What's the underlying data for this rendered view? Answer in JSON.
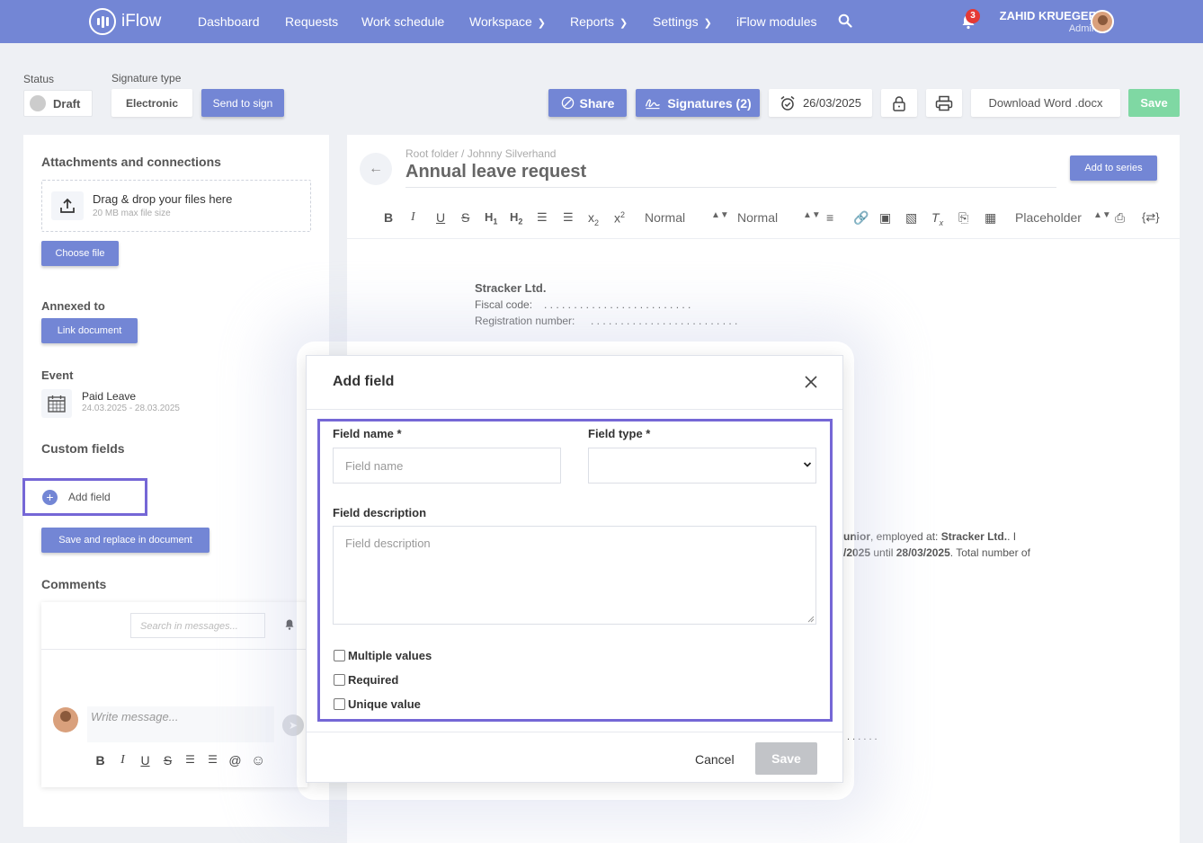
{
  "app": {
    "brand": "iFlow",
    "accent_color": "#7386d5",
    "highlight_color": "#7567d6"
  },
  "nav": {
    "items": [
      {
        "label": "Dashboard"
      },
      {
        "label": "Requests"
      },
      {
        "label": "Work schedule"
      },
      {
        "label": "Workspace"
      },
      {
        "label": "Reports"
      },
      {
        "label": "Settings"
      },
      {
        "label": "iFlow modules"
      }
    ],
    "notification_count": "3",
    "user_name": "ZAHID KRUEGER",
    "user_role": "Admin"
  },
  "toolbar": {
    "status_label": "Status",
    "status_value": "Draft",
    "signature_type_label": "Signature type",
    "signature_type_value": "Electronic",
    "send_to_sign": "Send to sign",
    "share": "Share",
    "signatures": "Signatures (2)",
    "date": "26/03/2025",
    "download": "Download Word .docx",
    "save": "Save"
  },
  "sidebar": {
    "attachments_title": "Attachments and connections",
    "dropzone_title": "Drag & drop your files here",
    "dropzone_sub": "20 MB max file size",
    "choose_file": "Choose file",
    "annexed_title": "Annexed to",
    "link_document": "Link document",
    "event_title": "Event",
    "event_name": "Paid Leave",
    "event_dates": "24.03.2025 - 28.03.2025",
    "custom_fields_title": "Custom fields",
    "add_field": "Add field",
    "save_replace": "Save and replace in document",
    "comments_title": "Comments",
    "search_placeholder": "Search in messages...",
    "write_placeholder": "Write message..."
  },
  "document": {
    "breadcrumb": "Root folder / Johnny Silverhand",
    "title": "Annual leave request",
    "add_to_series": "Add to series",
    "editor": {
      "format_1": "Normal",
      "format_2": "Normal",
      "placeholder": "Placeholder"
    },
    "company": "Stracker Ltd.",
    "fiscal_code": "Fiscal code:",
    "fiscal_dots": ". . . . . . . . . . . . . . . . . . . . . . . . .",
    "registration": "Registration number:",
    "registration_dots": ". . . . . . . . . . . . . . . . . . . . . . . . .",
    "body_frag1_bold": "unior",
    "body_frag1_rest": ", employed at: ",
    "body_frag1_company": "Stracker Ltd.",
    "body_frag1_end": ". I",
    "body_frag2_date1": "/2025",
    "body_frag2_mid": " until ",
    "body_frag2_date2": "28/03/2025",
    "body_frag2_end": ". Total number of",
    "dots_tail": ". . . . . ."
  },
  "modal": {
    "title": "Add field",
    "field_name_label": "Field name *",
    "field_name_placeholder": "Field name",
    "field_type_label": "Field type *",
    "field_description_label": "Field description",
    "field_description_placeholder": "Field description",
    "multiple_values": "Multiple values",
    "required": "Required",
    "unique_value": "Unique value",
    "cancel": "Cancel",
    "save": "Save"
  }
}
